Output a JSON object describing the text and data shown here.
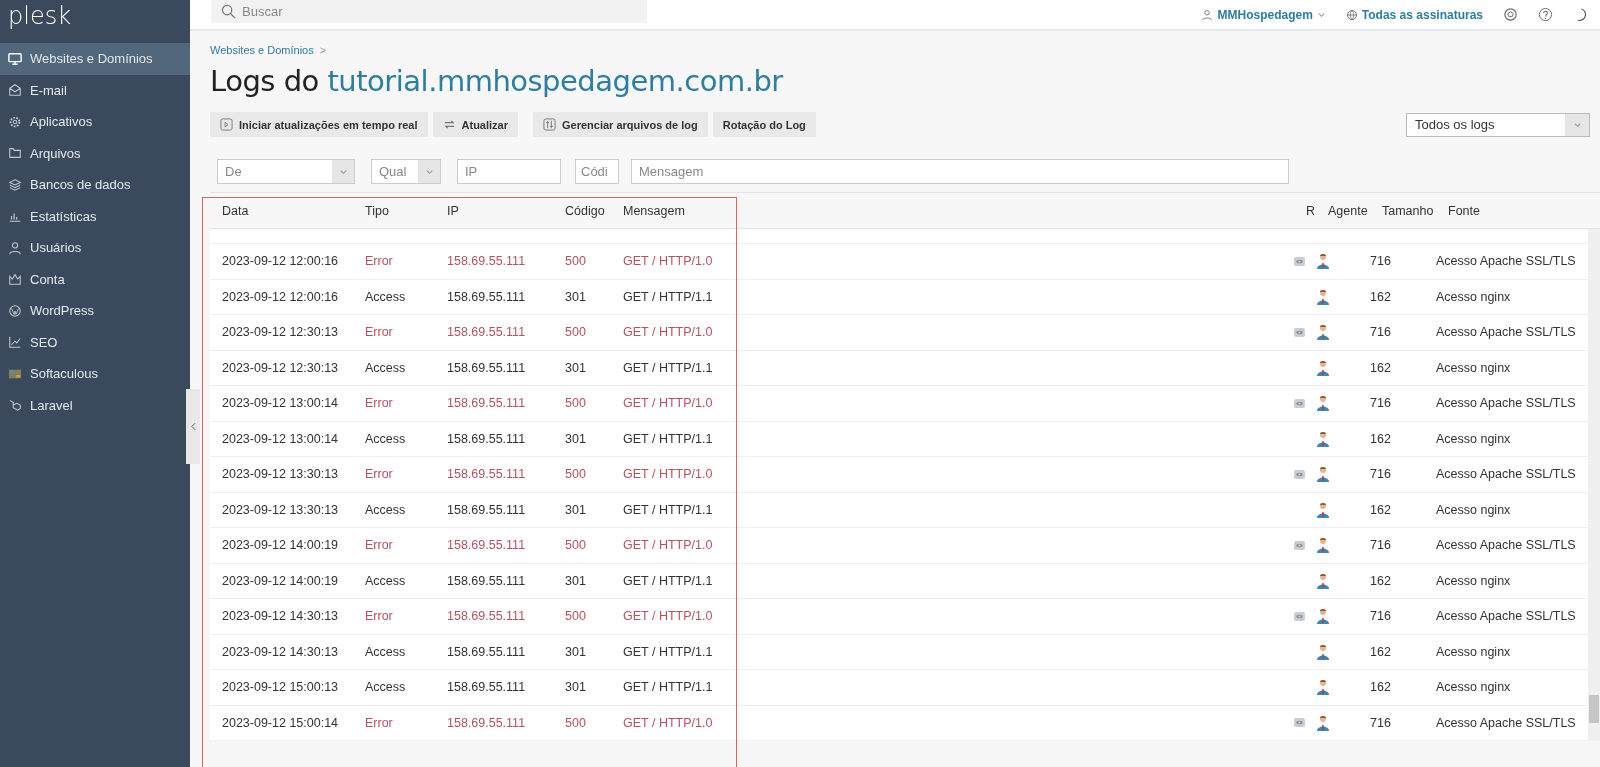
{
  "logo": "plesk",
  "sidebar": {
    "items": [
      {
        "label": "Websites e Domínios",
        "selected": true
      },
      {
        "label": "E-mail",
        "selected": false
      },
      {
        "label": "Aplicativos",
        "selected": false
      },
      {
        "label": "Arquivos",
        "selected": false
      },
      {
        "label": "Bancos de dados",
        "selected": false
      },
      {
        "label": "Estatísticas",
        "selected": false
      },
      {
        "label": "Usuários",
        "selected": false
      },
      {
        "label": "Conta",
        "selected": false
      },
      {
        "label": "WordPress",
        "selected": false
      },
      {
        "label": "SEO",
        "selected": false
      },
      {
        "label": "Softaculous",
        "selected": false
      },
      {
        "label": "Laravel",
        "selected": false
      }
    ]
  },
  "topbar": {
    "search": {
      "placeholder": "Buscar"
    },
    "user": "MMHospedagem",
    "subscriptions": "Todas as assinaturas"
  },
  "breadcrumb": "Websites e Domínios",
  "breadcrumb_separator": ">",
  "title": {
    "prefix": "Logs do",
    "domain": "tutorial.mmhospedagem.com.br"
  },
  "toolbar": [
    {
      "label": "Iniciar atualizações em tempo real"
    },
    {
      "label": "Atualizar"
    },
    {
      "label": "Gerenciar arquivos de log"
    },
    {
      "label": "Rotação do Log"
    }
  ],
  "log_select": {
    "value": "Todos os logs"
  },
  "filters": [
    {
      "placeholder": "De",
      "kind": "select"
    },
    {
      "placeholder": "Qual",
      "kind": "select"
    },
    {
      "placeholder": "IP",
      "kind": "text"
    },
    {
      "placeholder": "Códi",
      "kind": "text"
    },
    {
      "placeholder": "Mensagem",
      "kind": "text"
    }
  ],
  "table": {
    "columns": [
      "Data",
      "Tipo",
      "IP",
      "Código",
      "Mensagem",
      "R",
      "Agente",
      "Tamanho",
      "Fonte"
    ],
    "rows": [
      {
        "kind": "error",
        "date": "2023-09-12 12:00:16",
        "type": "Error",
        "ip": "158.69.55.111",
        "code": "500",
        "message": "GET / HTTP/1.0",
        "size": "716",
        "source": "Acesso Apache SSL/TLS"
      },
      {
        "kind": "access",
        "date": "2023-09-12 12:00:16",
        "type": "Access",
        "ip": "158.69.55.111",
        "code": "301",
        "message": "GET / HTTP/1.1",
        "size": "162",
        "source": "Acesso nginx"
      },
      {
        "kind": "error",
        "date": "2023-09-12 12:30:13",
        "type": "Error",
        "ip": "158.69.55.111",
        "code": "500",
        "message": "GET / HTTP/1.0",
        "size": "716",
        "source": "Acesso Apache SSL/TLS"
      },
      {
        "kind": "access",
        "date": "2023-09-12 12:30:13",
        "type": "Access",
        "ip": "158.69.55.111",
        "code": "301",
        "message": "GET / HTTP/1.1",
        "size": "162",
        "source": "Acesso nginx"
      },
      {
        "kind": "error",
        "date": "2023-09-12 13:00:14",
        "type": "Error",
        "ip": "158.69.55.111",
        "code": "500",
        "message": "GET / HTTP/1.0",
        "size": "716",
        "source": "Acesso Apache SSL/TLS"
      },
      {
        "kind": "access",
        "date": "2023-09-12 13:00:14",
        "type": "Access",
        "ip": "158.69.55.111",
        "code": "301",
        "message": "GET / HTTP/1.1",
        "size": "162",
        "source": "Acesso nginx"
      },
      {
        "kind": "error",
        "date": "2023-09-12 13:30:13",
        "type": "Error",
        "ip": "158.69.55.111",
        "code": "500",
        "message": "GET / HTTP/1.0",
        "size": "716",
        "source": "Acesso Apache SSL/TLS"
      },
      {
        "kind": "access",
        "date": "2023-09-12 13:30:13",
        "type": "Access",
        "ip": "158.69.55.111",
        "code": "301",
        "message": "GET / HTTP/1.1",
        "size": "162",
        "source": "Acesso nginx"
      },
      {
        "kind": "error",
        "date": "2023-09-12 14:00:19",
        "type": "Error",
        "ip": "158.69.55.111",
        "code": "500",
        "message": "GET / HTTP/1.0",
        "size": "716",
        "source": "Acesso Apache SSL/TLS"
      },
      {
        "kind": "access",
        "date": "2023-09-12 14:00:19",
        "type": "Access",
        "ip": "158.69.55.111",
        "code": "301",
        "message": "GET / HTTP/1.1",
        "size": "162",
        "source": "Acesso nginx"
      },
      {
        "kind": "error",
        "date": "2023-09-12 14:30:13",
        "type": "Error",
        "ip": "158.69.55.111",
        "code": "500",
        "message": "GET / HTTP/1.0",
        "size": "716",
        "source": "Acesso Apache SSL/TLS"
      },
      {
        "kind": "access",
        "date": "2023-09-12 14:30:13",
        "type": "Access",
        "ip": "158.69.55.111",
        "code": "301",
        "message": "GET / HTTP/1.1",
        "size": "162",
        "source": "Acesso nginx"
      },
      {
        "kind": "access",
        "date": "2023-09-12 15:00:13",
        "type": "Access",
        "ip": "158.69.55.111",
        "code": "301",
        "message": "GET / HTTP/1.1",
        "size": "162",
        "source": "Acesso nginx"
      },
      {
        "kind": "error",
        "date": "2023-09-12 15:00:14",
        "type": "Error",
        "ip": "158.69.55.111",
        "code": "500",
        "message": "GET / HTTP/1.0",
        "size": "716",
        "source": "Acesso Apache SSL/TLS"
      }
    ]
  }
}
